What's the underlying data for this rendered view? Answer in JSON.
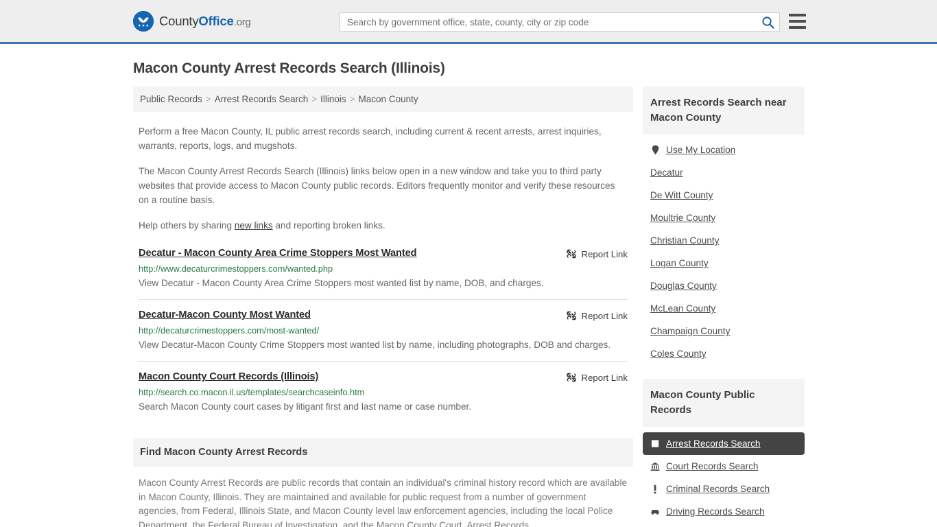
{
  "header": {
    "brand": {
      "part1": "County",
      "part2": "Office",
      "part3": ".org",
      "logo_icon": "eagle-stars-logo"
    },
    "search": {
      "placeholder": "Search by government office, state, county, city or zip code",
      "value": "",
      "search_icon": "search-icon"
    },
    "menu_icon": "hamburger-menu-icon"
  },
  "page": {
    "title": "Macon County Arrest Records Search (Illinois)"
  },
  "breadcrumb": {
    "items": [
      {
        "label": "Public Records",
        "current": false
      },
      {
        "label": "Arrest Records Search",
        "current": false
      },
      {
        "label": "Illinois",
        "current": false
      },
      {
        "label": "Macon County",
        "current": true
      }
    ],
    "separator": ">"
  },
  "intro": {
    "p1": "Perform a free Macon County, IL public arrest records search, including current & recent arrests, arrest inquiries, warrants, reports, logs, and mugshots.",
    "p2": "The Macon County Arrest Records Search (Illinois) links below open in a new window and take you to third party websites that provide access to Macon County public records. Editors frequently monitor and verify these resources on a routine basis.",
    "p3_before": "Help others by sharing ",
    "p3_link": "new links",
    "p3_after": " and reporting broken links."
  },
  "results": {
    "report_label": "Report Link",
    "report_icon": "broken-link-icon",
    "items": [
      {
        "title": "Decatur - Macon County Area Crime Stoppers Most Wanted",
        "url": "http://www.decaturcrimestoppers.com/wanted.php",
        "description": "View Decatur - Macon County Area Crime Stoppers most wanted list by name, DOB, and charges."
      },
      {
        "title": "Decatur-Macon County Most Wanted",
        "url": "http://decaturcrimestoppers.com/most-wanted/",
        "description": "View Decatur-Macon County Crime Stoppers most wanted list by name, including photographs, DOB and charges."
      },
      {
        "title": "Macon County Court Records (Illinois)",
        "url": "http://search.co.macon.il.us/templates/searchcaseinfo.htm",
        "description": "Search Macon County court cases by litigant first and last name or case number."
      }
    ]
  },
  "find_section": {
    "heading": "Find Macon County Arrest Records",
    "body": "Macon County Arrest Records are public records that contain an individual's criminal history record which are available in Macon County, Illinois. They are maintained and available for public request from a number of government agencies, from Federal, Illinois State, and Macon County level law enforcement agencies, including the local Police Department, the Federal Bureau of Investigation, and the Macon County Court. Arrest Records"
  },
  "sidebar": {
    "near_heading": "Arrest Records Search near Macon County",
    "near_items": [
      {
        "label": "Use My Location",
        "icon": "map-pin-icon"
      },
      {
        "label": "Decatur",
        "icon": ""
      },
      {
        "label": "De Witt County",
        "icon": ""
      },
      {
        "label": "Moultrie County",
        "icon": ""
      },
      {
        "label": "Christian County",
        "icon": ""
      },
      {
        "label": "Logan County",
        "icon": ""
      },
      {
        "label": "Douglas County",
        "icon": ""
      },
      {
        "label": "McLean County",
        "icon": ""
      },
      {
        "label": "Champaign County",
        "icon": ""
      },
      {
        "label": "Coles County",
        "icon": ""
      }
    ],
    "public_heading": "Macon County Public Records",
    "public_items": [
      {
        "label": "Arrest Records Search",
        "icon": "handcuffs-icon",
        "active": true
      },
      {
        "label": "Court Records Search",
        "icon": "courthouse-icon",
        "active": false
      },
      {
        "label": "Criminal Records Search",
        "icon": "exclamation-icon",
        "active": false
      },
      {
        "label": "Driving Records Search",
        "icon": "car-icon",
        "active": false
      }
    ]
  },
  "colors": {
    "brand_blue": "#1565b0",
    "header_border": "#3b77ad",
    "url_green": "#2a7a3f",
    "active_bg": "#444444",
    "panel_bg": "#f4f4f4"
  }
}
